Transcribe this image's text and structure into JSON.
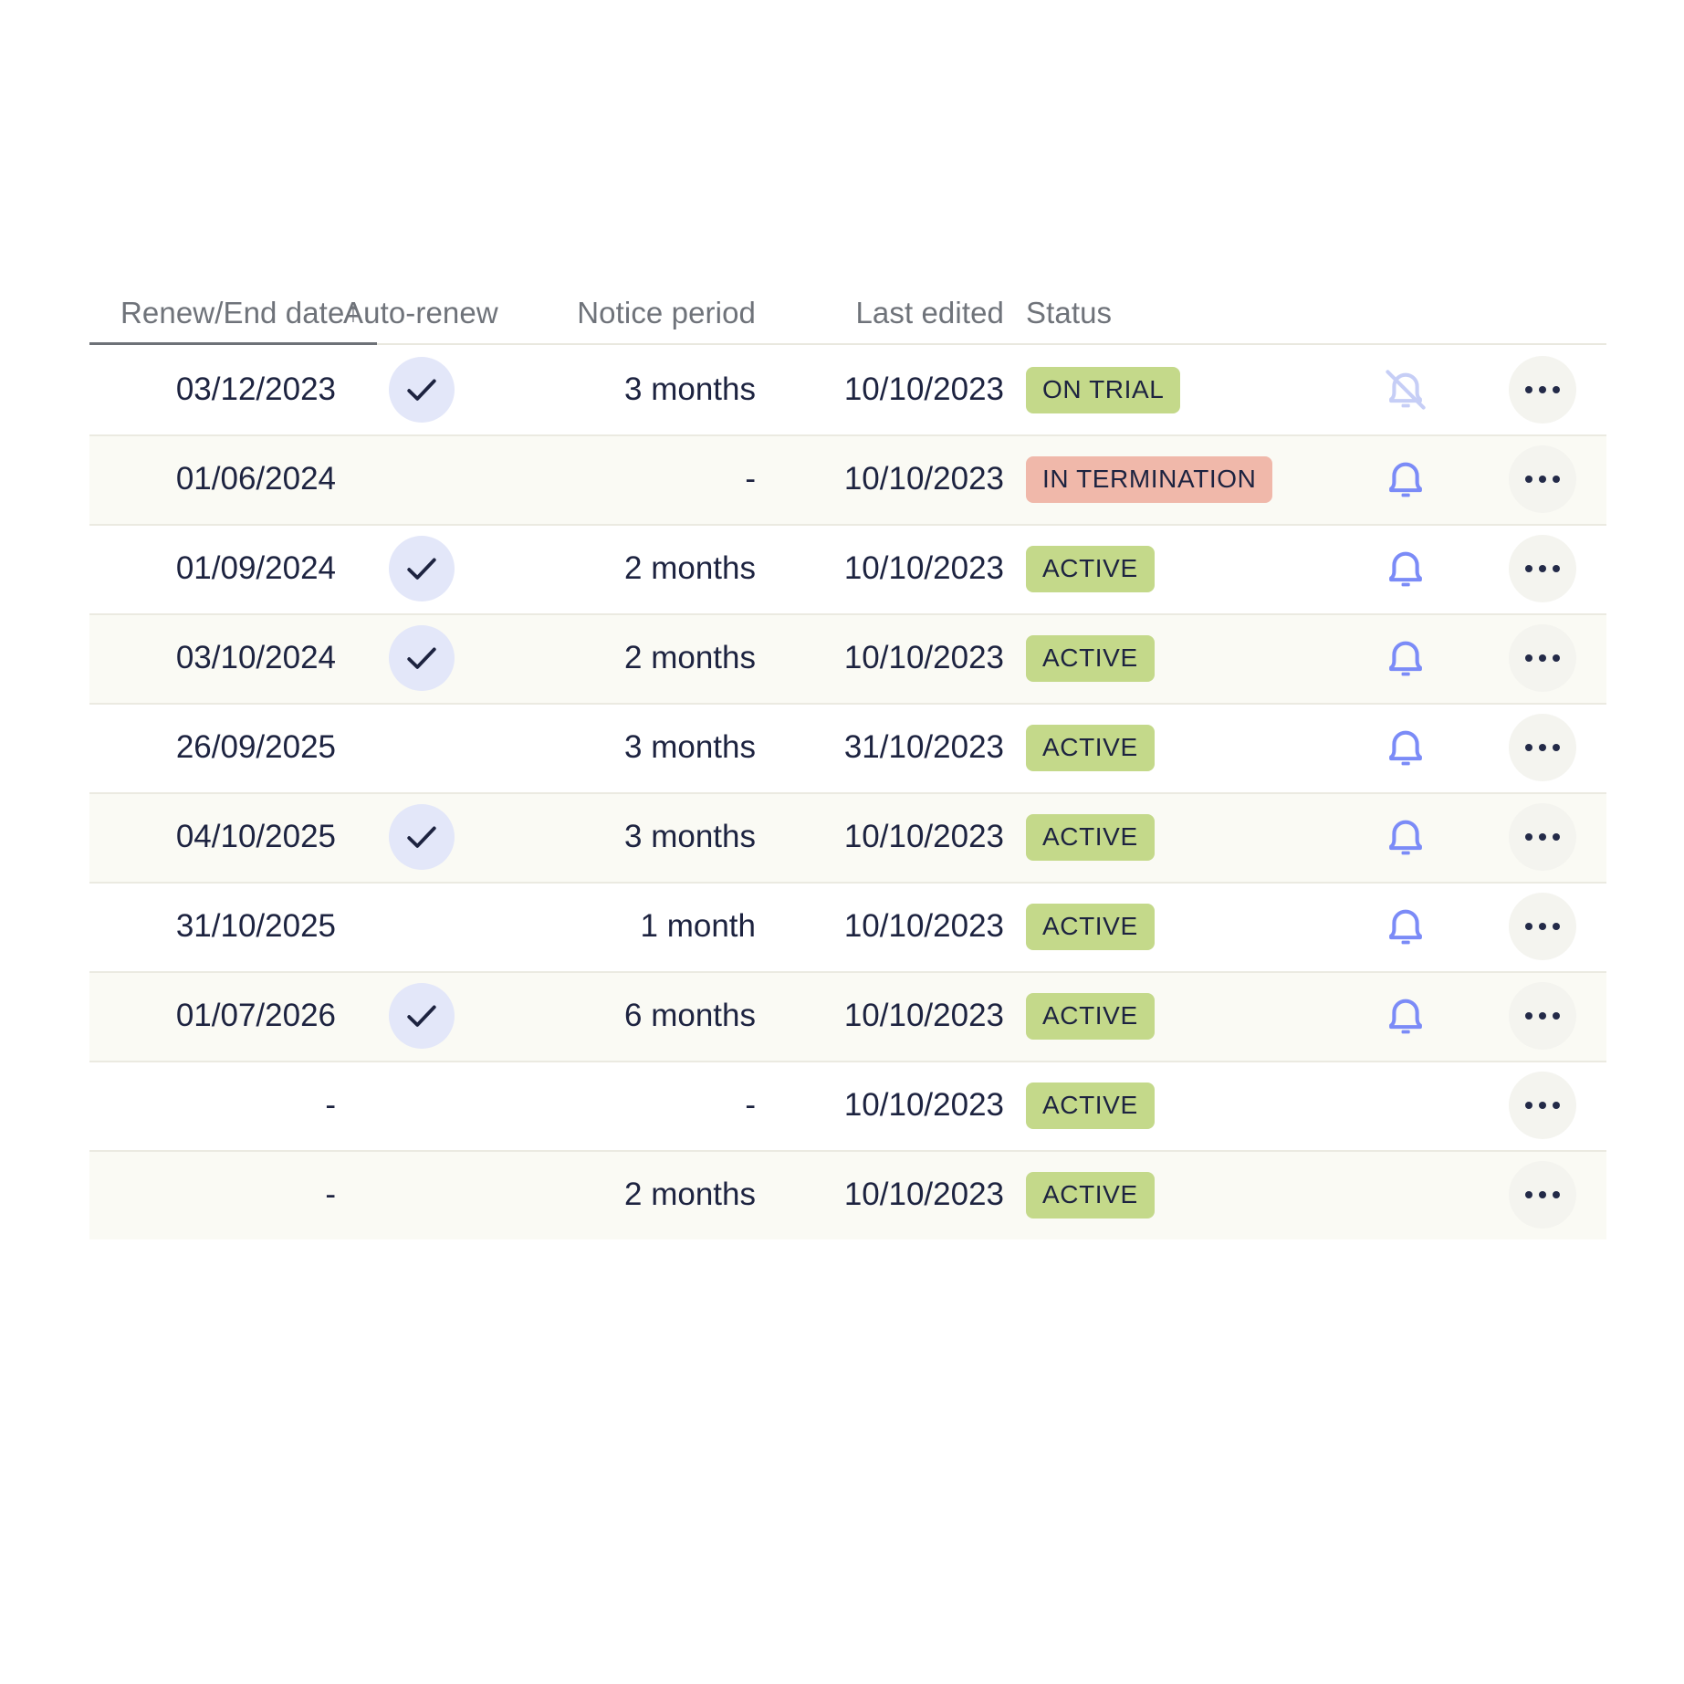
{
  "table": {
    "columns": [
      {
        "key": "renew_end_date",
        "label": "Renew/End date",
        "sorted": true,
        "sort_direction": "asc",
        "sort_arrow": "↑",
        "align": "right"
      },
      {
        "key": "auto_renew",
        "label": "Auto-renew",
        "sorted": false,
        "align": "center"
      },
      {
        "key": "notice_period",
        "label": "Notice period",
        "sorted": false,
        "align": "right"
      },
      {
        "key": "last_edited",
        "label": "Last edited",
        "sorted": false,
        "align": "right"
      },
      {
        "key": "status",
        "label": "Status",
        "sorted": false,
        "align": "left"
      }
    ],
    "rows": [
      {
        "renew_end_date": "03/12/2023",
        "auto_renew": true,
        "notice_period": "3 months",
        "last_edited": "10/10/2023",
        "status": "ON TRIAL",
        "status_kind": "green",
        "bell": "bell-off",
        "menu": "···"
      },
      {
        "renew_end_date": "01/06/2024",
        "auto_renew": false,
        "notice_period": "-",
        "last_edited": "10/10/2023",
        "status": "IN TERMINATION",
        "status_kind": "red",
        "bell": "bell-on",
        "menu": "···"
      },
      {
        "renew_end_date": "01/09/2024",
        "auto_renew": true,
        "notice_period": "2 months",
        "last_edited": "10/10/2023",
        "status": "ACTIVE",
        "status_kind": "green",
        "bell": "bell-on",
        "menu": "···"
      },
      {
        "renew_end_date": "03/10/2024",
        "auto_renew": true,
        "notice_period": "2 months",
        "last_edited": "10/10/2023",
        "status": "ACTIVE",
        "status_kind": "green",
        "bell": "bell-on",
        "menu": "···"
      },
      {
        "renew_end_date": "26/09/2025",
        "auto_renew": false,
        "notice_period": "3 months",
        "last_edited": "31/10/2023",
        "status": "ACTIVE",
        "status_kind": "green",
        "bell": "bell-on",
        "menu": "···"
      },
      {
        "renew_end_date": "04/10/2025",
        "auto_renew": true,
        "notice_period": "3 months",
        "last_edited": "10/10/2023",
        "status": "ACTIVE",
        "status_kind": "green",
        "bell": "bell-on",
        "menu": "···"
      },
      {
        "renew_end_date": "31/10/2025",
        "auto_renew": false,
        "notice_period": "1 month",
        "last_edited": "10/10/2023",
        "status": "ACTIVE",
        "status_kind": "green",
        "bell": "bell-on",
        "menu": "···"
      },
      {
        "renew_end_date": "01/07/2026",
        "auto_renew": true,
        "notice_period": "6 months",
        "last_edited": "10/10/2023",
        "status": "ACTIVE",
        "status_kind": "green",
        "bell": "bell-on",
        "menu": "···"
      },
      {
        "renew_end_date": "-",
        "auto_renew": false,
        "notice_period": "-",
        "last_edited": "10/10/2023",
        "status": "ACTIVE",
        "status_kind": "green",
        "bell": "none",
        "menu": "···"
      },
      {
        "renew_end_date": "-",
        "auto_renew": false,
        "notice_period": "2 months",
        "last_edited": "10/10/2023",
        "status": "ACTIVE",
        "status_kind": "green",
        "bell": "none",
        "menu": "···"
      }
    ]
  },
  "colors": {
    "badge_green_bg": "#c4d98a",
    "badge_red_bg": "#f0b8aa",
    "badge_text": "#1d2340",
    "text_primary": "#1d2340",
    "header_text": "#6f737a",
    "row_alt_bg": "#fafaf4",
    "row_divider": "#ebeae1",
    "sort_underline": "#6d7177",
    "check_pill_bg": "#e3e7f9",
    "check_mark": "#1d2340",
    "bell_on": "#7b8bf7",
    "bell_off": "#c6cef6",
    "kebab_bg": "#f4f4ef",
    "kebab_dot": "#232a48"
  }
}
